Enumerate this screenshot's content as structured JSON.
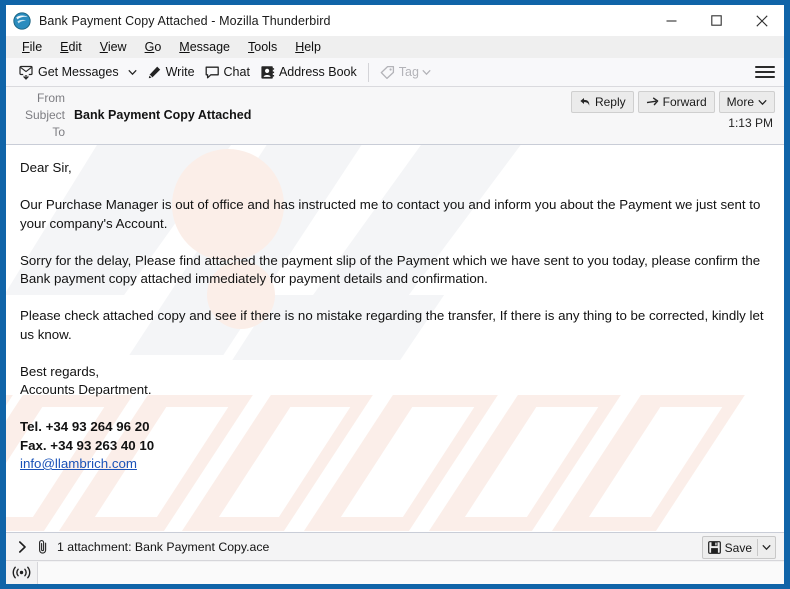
{
  "window": {
    "title": "Bank Payment Copy Attached - Mozilla Thunderbird",
    "app_icon": "thunderbird-icon",
    "controls": {
      "minimize": "minimize-icon",
      "maximize": "maximize-icon",
      "close": "close-icon"
    },
    "border_color": "#1064a8"
  },
  "menubar": {
    "items": [
      {
        "label": "File",
        "accel": "F"
      },
      {
        "label": "Edit",
        "accel": "E"
      },
      {
        "label": "View",
        "accel": "V"
      },
      {
        "label": "Go",
        "accel": "G"
      },
      {
        "label": "Message",
        "accel": "M"
      },
      {
        "label": "Tools",
        "accel": "T"
      },
      {
        "label": "Help",
        "accel": "H"
      }
    ]
  },
  "toolbar": {
    "get_messages": "Get Messages",
    "write": "Write",
    "chat": "Chat",
    "address_book": "Address Book",
    "tag": "Tag",
    "app_menu": "hamburger-menu-icon"
  },
  "message_header": {
    "from_label": "From",
    "from_value": "",
    "subject_label": "Subject",
    "subject_value": "Bank Payment Copy Attached",
    "to_label": "To",
    "to_value": "",
    "time": "1:13 PM",
    "actions": {
      "reply": "Reply",
      "forward": "Forward",
      "more": "More"
    }
  },
  "message_body": {
    "watermark": "pcrisk.com",
    "link_color": "#1a52b8",
    "paragraphs": [
      "Dear Sir,",
      "Our Purchase Manager is out of office and has instructed me to contact you and inform you about the Payment we just sent to your company's Account.",
      "Sorry for the delay, Please find attached the payment slip of the Payment which we have sent to you today, please confirm the Bank payment copy attached immediately for payment details and confirmation.",
      "Please check attached copy and see if there is no mistake regarding the transfer, If there is any thing to be corrected, kindly let us know."
    ],
    "signoff_line1": "Best regards,",
    "signoff_line2": "Accounts Department.",
    "tel": "Tel. +34 93 264 96 20",
    "fax": "Fax. +34 93 263 40 10",
    "email_link": "info@llambrich.com"
  },
  "attachment_bar": {
    "expander": "chevron-right-icon",
    "clip_icon": "paperclip-icon",
    "text": "1 attachment: Bank Payment Copy.ace",
    "save_label": "Save",
    "save_icon": "save-disk-icon",
    "save_caret": "chevron-down-icon"
  },
  "status_bar": {
    "icon": "broadcast-icon"
  }
}
